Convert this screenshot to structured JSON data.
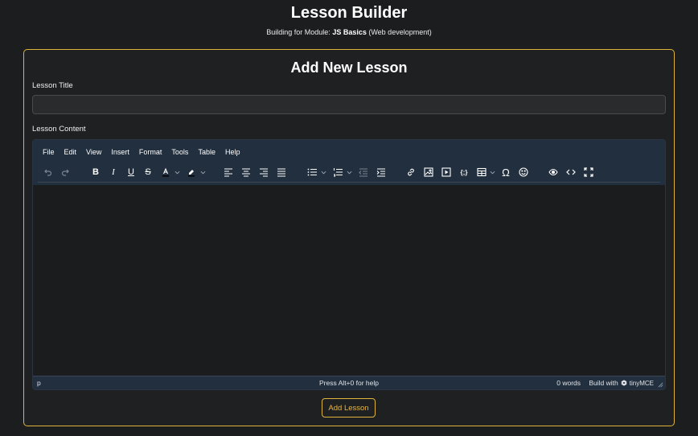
{
  "header": {
    "title": "Lesson Builder",
    "subtitle_prefix": "Building for Module: ",
    "module_name": "JS Basics",
    "subtitle_suffix": " (Web development)"
  },
  "form": {
    "title": "Add New Lesson",
    "lesson_title_label": "Lesson Title",
    "lesson_title_value": "",
    "lesson_content_label": "Lesson Content",
    "submit_label": "Add Lesson"
  },
  "editor": {
    "menu": [
      "File",
      "Edit",
      "View",
      "Insert",
      "Format",
      "Tools",
      "Table",
      "Help"
    ],
    "toolbar_icons": [
      "undo-icon",
      "redo-icon",
      "bold-icon",
      "italic-icon",
      "underline-icon",
      "strikethrough-icon",
      "text-color-icon",
      "highlight-color-icon",
      "align-left-icon",
      "align-center-icon",
      "align-right-icon",
      "align-justify-icon",
      "bullet-list-icon",
      "numbered-list-icon",
      "outdent-icon",
      "indent-icon",
      "link-icon",
      "image-icon",
      "media-icon",
      "code-sample-icon",
      "table-icon",
      "special-char-icon",
      "emoji-icon",
      "preview-icon",
      "source-code-icon",
      "fullscreen-icon"
    ],
    "status_path": "p",
    "status_help": "Press Alt+0 for help",
    "word_count": "0 words",
    "build_with": "Build with",
    "brand": "tinyMCE"
  },
  "colors": {
    "background": "#1c1d1f",
    "accent": "#e0b43a",
    "editor_chrome": "#222f3e"
  }
}
